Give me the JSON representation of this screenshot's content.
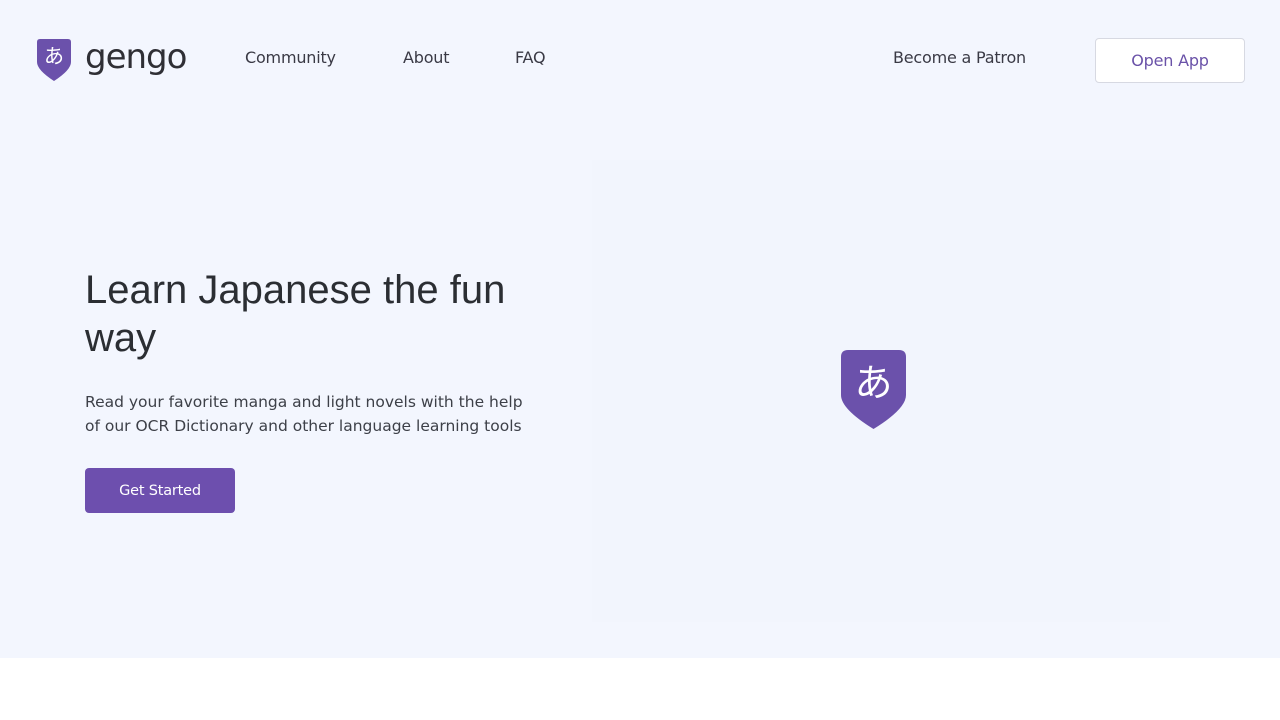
{
  "brand": {
    "name": "gengo",
    "glyph": "あ",
    "color": "#6b51ab",
    "logo_icon": "hiragana-a-shield-icon"
  },
  "nav": {
    "links": [
      "Community",
      "About",
      "FAQ"
    ],
    "patron_label": "Become a Patron",
    "open_app_label": "Open App"
  },
  "hero": {
    "headline": "Learn Japanese the fun way",
    "subtext": "Read your favorite manga and light novels with the help of our OCR Dictionary and other language learning tools",
    "cta_label": "Get Started",
    "illustration_icon": "hiragana-a-shield-icon"
  },
  "colors": {
    "hero_background": "#f3f6fe",
    "accent": "#6d4fae",
    "text": "#2b2e33"
  }
}
